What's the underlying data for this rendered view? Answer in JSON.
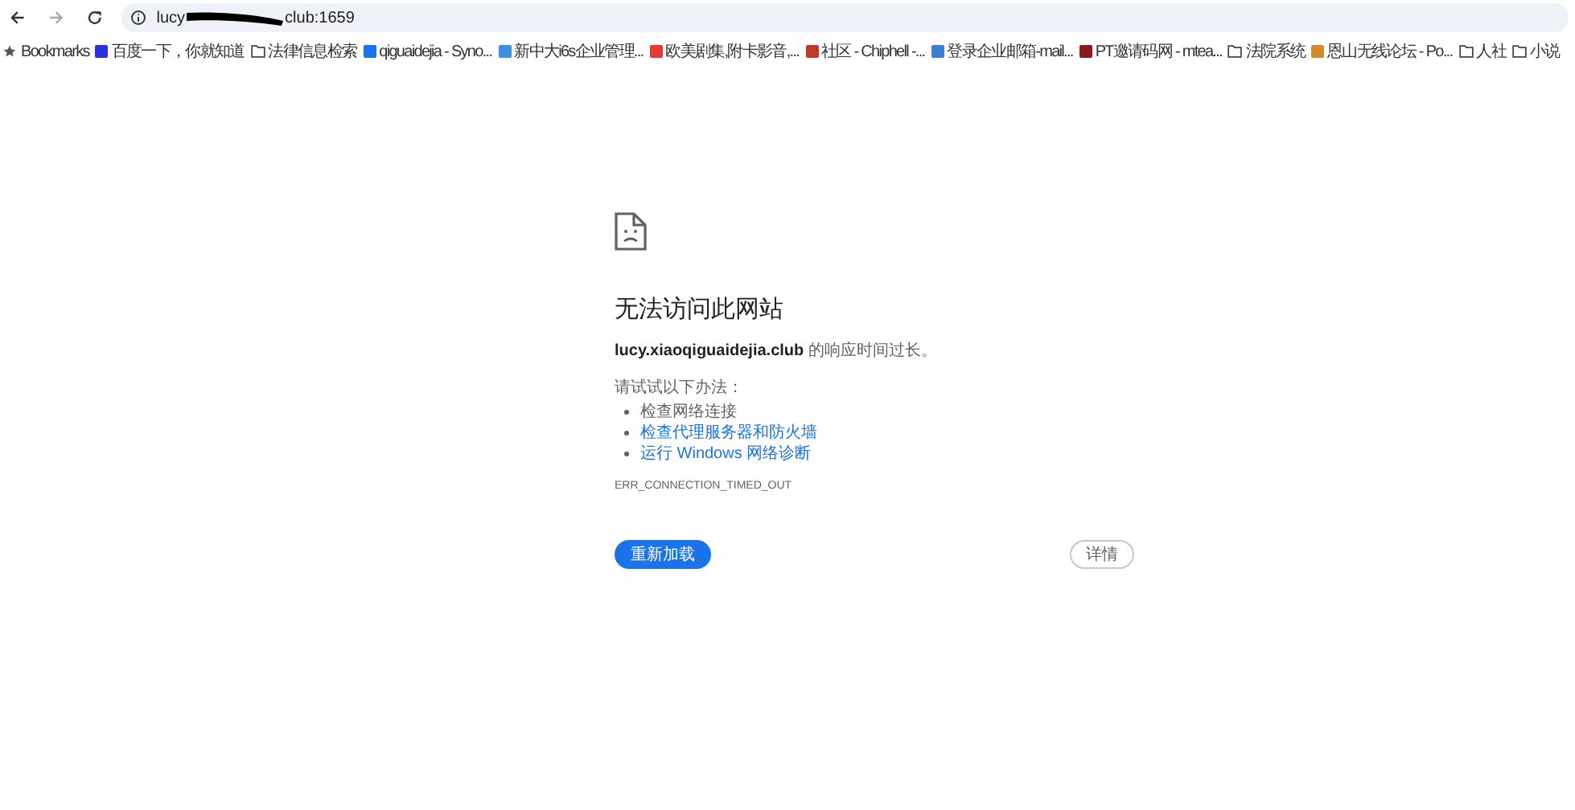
{
  "address_bar": {
    "text_before_redaction": "lucy",
    "text_after_redaction": "club:1659"
  },
  "bookmarks_label": "Bookmarks",
  "bookmarks": [
    {
      "kind": "site",
      "label": "百度一下，你就知道",
      "color": "#2932e1"
    },
    {
      "kind": "folder",
      "label": "法律信息检索"
    },
    {
      "kind": "site",
      "label": "qiguaidejia - Syno...",
      "color": "#1a73e8"
    },
    {
      "kind": "site",
      "label": "新中大i6s企业管理...",
      "color": "#3d8fe0"
    },
    {
      "kind": "site",
      "label": "欧美剧集,附卡影音,...",
      "color": "#e53935"
    },
    {
      "kind": "site",
      "label": "社区 - Chiphell -...",
      "color": "#c0392b"
    },
    {
      "kind": "site",
      "label": "登录企业邮箱-mail...",
      "color": "#3b7dd8"
    },
    {
      "kind": "site",
      "label": "PT邀请码网 - mtea...",
      "color": "#8b1a1a"
    },
    {
      "kind": "folder",
      "label": "法院系统"
    },
    {
      "kind": "site",
      "label": "恩山无线论坛 - Po...",
      "color": "#d4892a"
    },
    {
      "kind": "folder",
      "label": "人社"
    },
    {
      "kind": "folder",
      "label": "小说"
    }
  ],
  "error": {
    "title": "无法访问此网站",
    "host": "lucy.xiaoqiguaidejia.club",
    "message": "的响应时间过长。",
    "suggestion_intro": "请试试以下办法：",
    "suggestions": [
      {
        "kind": "text",
        "label": "检查网络连接"
      },
      {
        "kind": "link",
        "label": "检查代理服务器和防火墙"
      },
      {
        "kind": "link",
        "label": "运行 Windows 网络诊断"
      }
    ],
    "code": "ERR_CONNECTION_TIMED_OUT",
    "reload_button": "重新加载",
    "details_button": "详情"
  }
}
